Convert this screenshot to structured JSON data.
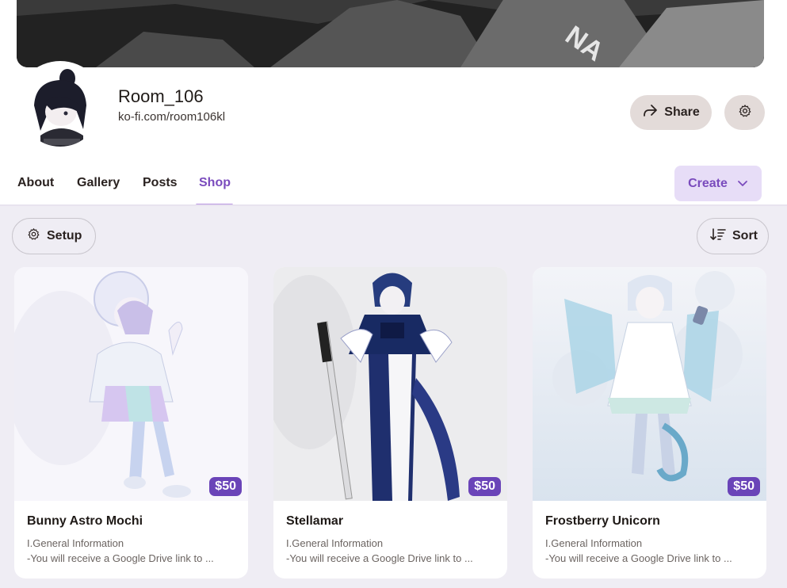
{
  "profile": {
    "name": "Room_106",
    "url": "ko-fi.com/room106kl",
    "share_label": "Share"
  },
  "tabs": [
    {
      "label": "About"
    },
    {
      "label": "Gallery"
    },
    {
      "label": "Posts"
    },
    {
      "label": "Shop",
      "active": true
    }
  ],
  "create_label": "Create",
  "toolbar": {
    "setup_label": "Setup",
    "sort_label": "Sort"
  },
  "products": [
    {
      "title": "Bunny Astro Mochi",
      "price": "$50",
      "desc_line1": "I.General Information",
      "desc_line2": "-You will receive a Google Drive link to ..."
    },
    {
      "title": "Stellamar",
      "price": "$50",
      "desc_line1": "I.General Information",
      "desc_line2": "-You will receive a Google Drive link to ..."
    },
    {
      "title": "Frostberry Unicorn",
      "price": "$50",
      "desc_line1": "I.General Information",
      "desc_line2": "-You will receive a Google Drive link to ..."
    }
  ],
  "colors": {
    "accent": "#7a4bbd",
    "price_badge": "#6a44b8",
    "shop_background": "#efedf4",
    "button_background": "#e3dbd9"
  },
  "icons": {
    "share": "share-arrow-icon",
    "settings": "gear-icon",
    "create_dropdown": "chevron-down-icon",
    "setup": "gear-icon",
    "sort": "sort-descending-icon"
  }
}
